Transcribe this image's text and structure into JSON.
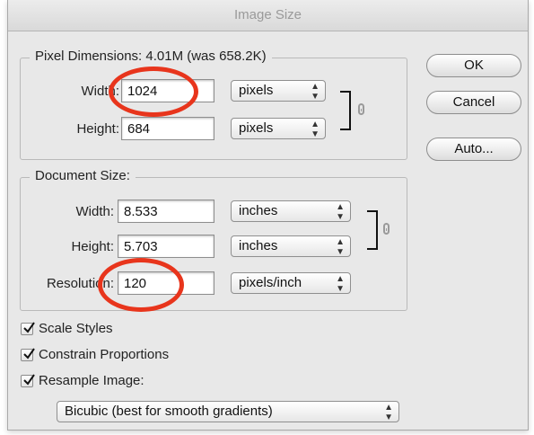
{
  "dialog": {
    "title": "Image Size",
    "buttons": {
      "ok": "OK",
      "cancel": "Cancel",
      "auto": "Auto..."
    }
  },
  "pixel_dimensions": {
    "legend": "Pixel Dimensions:  4.01M (was 658.2K)",
    "width_label": "Width:",
    "width_value": "1024",
    "width_unit": "pixels",
    "height_label": "Height:",
    "height_value": "684",
    "height_unit": "pixels"
  },
  "document_size": {
    "legend": "Document Size:",
    "width_label": "Width:",
    "width_value": "8.533",
    "width_unit": "inches",
    "height_label": "Height:",
    "height_value": "5.703",
    "height_unit": "inches",
    "resolution_label": "Resolution:",
    "resolution_value": "120",
    "resolution_unit": "pixels/inch"
  },
  "options": {
    "scale_styles": "Scale Styles",
    "constrain_proportions": "Constrain Proportions",
    "resample_image": "Resample Image:",
    "resample_method": "Bicubic (best for smooth gradients)"
  },
  "highlight_color": "#e8351c"
}
